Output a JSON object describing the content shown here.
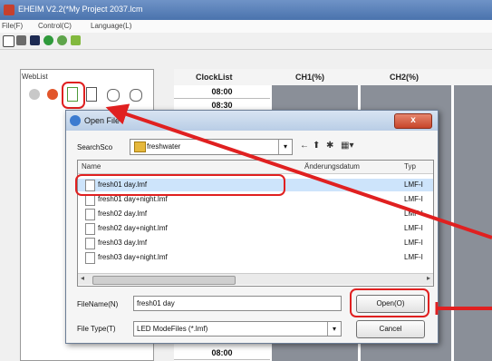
{
  "window": {
    "title": "EHEIM V2.2(*My Project 2037.lcm",
    "menu": [
      "File(F)",
      "Control(C)",
      "Language(L)"
    ]
  },
  "sidebar": {
    "title": "WebList"
  },
  "grid": {
    "headers": [
      "ClockList",
      "CH1(%)",
      "CH2(%)"
    ],
    "clock_values": [
      "08:00",
      "08:30",
      "08:00"
    ]
  },
  "dialog": {
    "title": "Open File",
    "close_label": "x",
    "search_in_label": "SearchSco",
    "search_in_value": "freshwater",
    "columns": {
      "name": "Name",
      "date": "Änderungsdatum",
      "type": "Typ"
    },
    "files": [
      {
        "name": "fresh01 day.lmf",
        "type": "LMF-I"
      },
      {
        "name": "fresh01 day+night.lmf",
        "type": "LMF-I"
      },
      {
        "name": "fresh02 day.lmf",
        "type": "LMF-I"
      },
      {
        "name": "fresh02 day+night.lmf",
        "type": "LMF-I"
      },
      {
        "name": "fresh03 day.lmf",
        "type": "LMF-I"
      },
      {
        "name": "fresh03 day+night.lmf",
        "type": "LMF-I"
      }
    ],
    "filename_label": "FileName(N)",
    "filename_value": "fresh01 day",
    "filetype_label": "File Type(T)",
    "filetype_value": "LED ModeFiles (*.lmf)",
    "open_label": "Open(O)",
    "cancel_label": "Cancel"
  },
  "colors": {
    "annotation": "#e02020",
    "titlebar": "#4a73ad",
    "selection": "#cde4fb"
  }
}
